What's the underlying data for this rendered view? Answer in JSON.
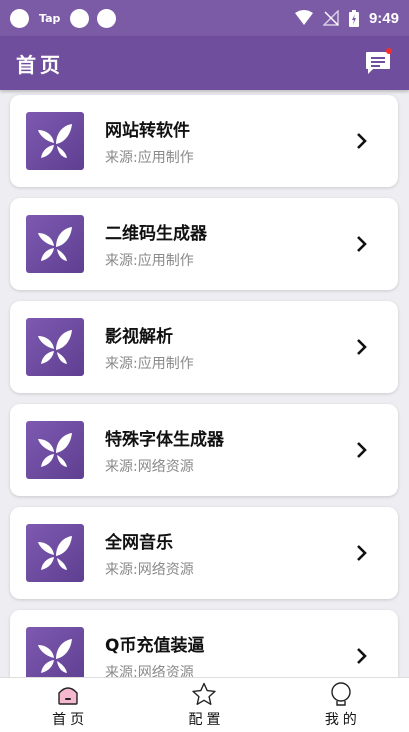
{
  "status_bar": {
    "tap_label": "Tap",
    "time": "9:49"
  },
  "appbar": {
    "title": "首页"
  },
  "apps": [
    {
      "title": "网站转软件",
      "source": "来源:应用制作"
    },
    {
      "title": "二维码生成器",
      "source": "来源:应用制作"
    },
    {
      "title": "影视解析",
      "source": "来源:应用制作"
    },
    {
      "title": "特殊字体生成器",
      "source": "来源:网络资源"
    },
    {
      "title": "全网音乐",
      "source": "来源:网络资源"
    },
    {
      "title": "Q币充值装逼",
      "source": "来源:网络资源"
    }
  ],
  "bottom_nav": [
    {
      "label": "首页",
      "icon": "home-icon"
    },
    {
      "label": "配置",
      "icon": "star-icon"
    },
    {
      "label": "我的",
      "icon": "profile-icon"
    }
  ],
  "colors": {
    "status_bar": "#7b5aa6",
    "appbar": "#6f4f9d",
    "badge": "#f23030",
    "home_icon_fill": "#f6b8cf"
  }
}
